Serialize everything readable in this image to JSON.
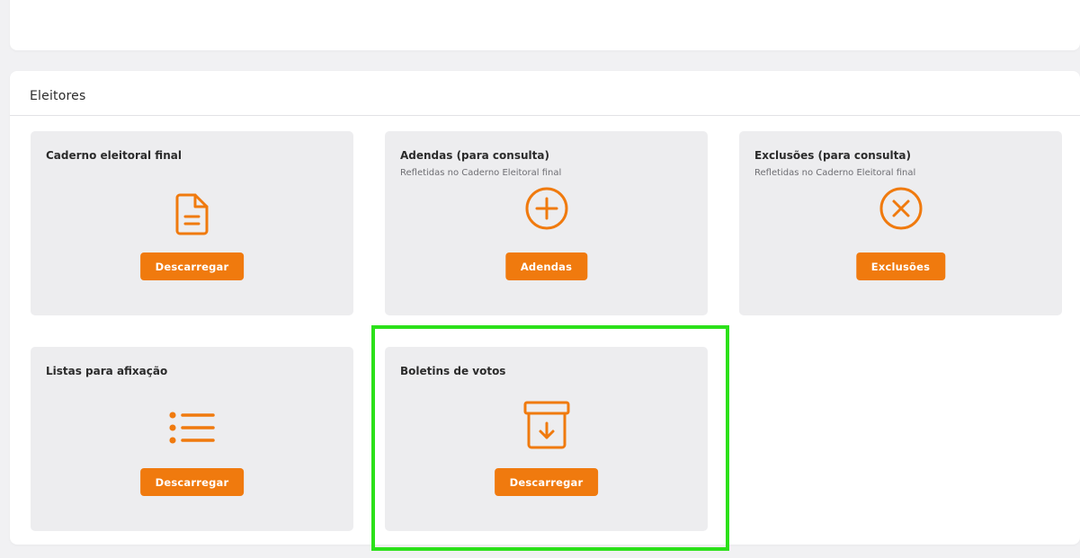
{
  "section": {
    "title": "Eleitores"
  },
  "tiles": [
    {
      "title": "Caderno eleitoral final",
      "subtitle": "",
      "icon": "document-icon",
      "button_label": "Descarregar"
    },
    {
      "title": "Adendas (para consulta)",
      "subtitle": "Refletidas no Caderno Eleitoral final",
      "icon": "plus-circle-icon",
      "button_label": "Adendas"
    },
    {
      "title": "Exclusões (para consulta)",
      "subtitle": "Refletidas no Caderno Eleitoral final",
      "icon": "x-circle-icon",
      "button_label": "Exclusões"
    },
    {
      "title": "Listas para afixação",
      "subtitle": "",
      "icon": "list-icon",
      "button_label": "Descarregar"
    },
    {
      "title": "Boletins de votos",
      "subtitle": "",
      "icon": "archive-download-icon",
      "button_label": "Descarregar"
    }
  ],
  "colors": {
    "accent": "#f07a0e",
    "highlight": "#2ce11a",
    "tile_background": "#ededef"
  }
}
